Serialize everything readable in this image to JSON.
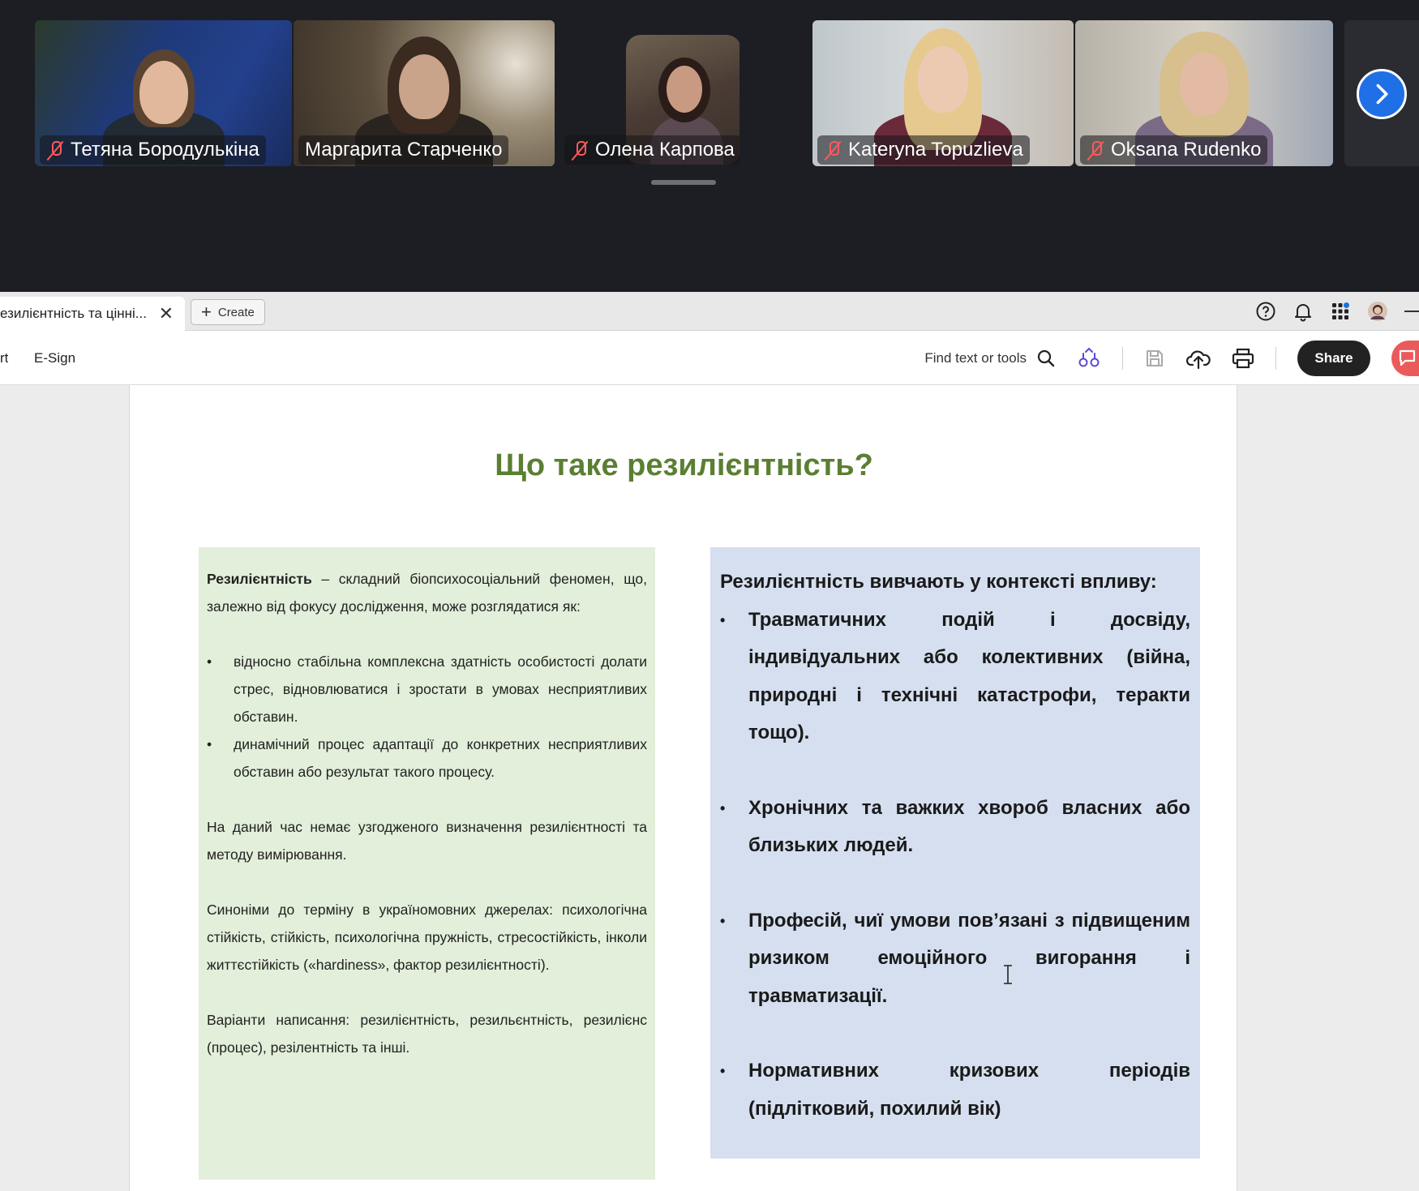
{
  "participants": [
    {
      "name": "Тетяна Бородулькіна",
      "muted": true
    },
    {
      "name": "Маргарита Старченко",
      "muted": false,
      "active_speaker": true
    },
    {
      "name": "Олена Карпова",
      "muted": true
    },
    {
      "name": "Kateryna Topuzlieva",
      "muted": true
    },
    {
      "name": "Oksana Rudenko",
      "muted": true
    }
  ],
  "colors": {
    "active_border": "#1fd67a",
    "muted_icon": "#ff5a5a",
    "next_button": "#1f6fe6",
    "title_green": "#5b7f32",
    "left_box_bg": "#e2efda",
    "right_box_bg": "#d5dfef",
    "share_button": "#222222",
    "ai_button": "#eb5a5a"
  },
  "tabbar": {
    "doc_tab_title": "езилієнтність та цінні...",
    "create_label": "Create",
    "icons": [
      "help-icon",
      "bell-icon",
      "apps-grid-icon",
      "profile-avatar"
    ]
  },
  "toolbar": {
    "partial_item": "rt",
    "esign_label": "E-Sign",
    "find_label": "Find text or tools",
    "share_label": "Share"
  },
  "slide": {
    "title": "Що таке резилієнтність?",
    "left": {
      "intro_bold": "Резилієнтність",
      "intro_rest": " – складний біопсихосоціальний феномен, що, залежно від фокусу дослідження, може розглядатися як:",
      "bullets": [
        "відносно стабільна комплексна здатність особистості долати стрес, відновлюватися і зростати в умовах несприятливих обставин.",
        "динамічний процес адаптації до конкретних несприятливих обставин або результат такого процесу."
      ],
      "para2": "На даний час немає узгодженого визначення резилієнтності та методу вимірювання.",
      "para3": "Синоніми до терміну в україномовних джерелах: психологічна стійкість, стійкість, психологічна пружність, стресостійкість, інколи життєстійкість («hardiness», фактор резилієнтності).",
      "para4": "Варіанти написання: резилієнтність, резильєнтність, резилієнс (процес), резілентність та інші."
    },
    "right": {
      "lead": "Резилієнтність вивчають у контексті впливу:",
      "bullets": [
        "Травматичних подій і досвіду, індивідуальних або колективних (війна, природні і технічні катастрофи, теракти тощо).",
        "Хронічних та важких хвороб власних або близьких людей.",
        "Професій, чиї умови пов’язані з підвищеним ризиком емоційного вигорання і травматизації.",
        "Нормативних кризових періодів (підлітковий, похилий вік)"
      ]
    }
  }
}
